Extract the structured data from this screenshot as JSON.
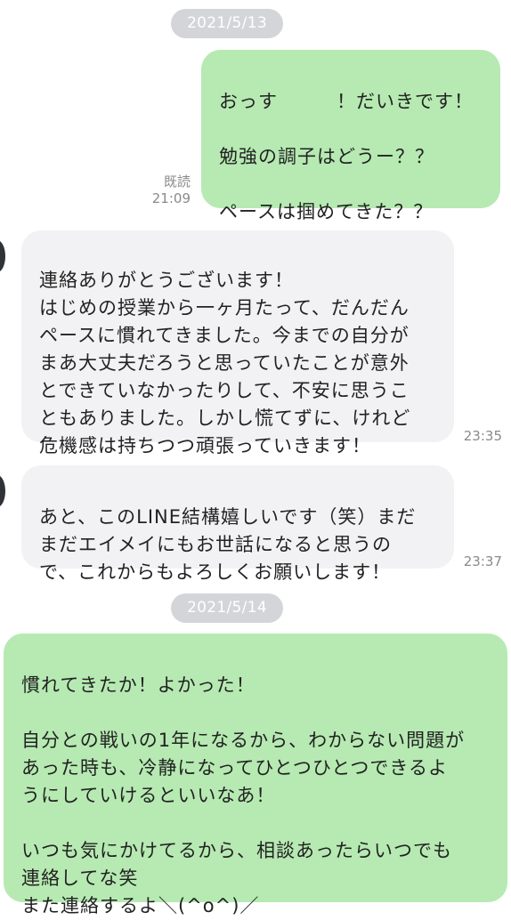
{
  "colors": {
    "outgoing_bubble": "#b6eab2",
    "incoming_bubble": "#f2f2f4",
    "date_pill": "#d4d5d9",
    "meta_text": "#8a8a8a"
  },
  "messages": {
    "date1": "2021/5/13",
    "out1": {
      "text": "おっす　　　！だいきです！\n\n勉強の調子はどうー？？\n\nペースは掴めてきた？？",
      "read": "既読",
      "time": "21:09"
    },
    "in1": {
      "text": "連絡ありがとうございます！\nはじめの授業から一ヶ月たって、だんだん\nペースに慣れてきました。今までの自分が\nまあ大丈夫だろうと思っていたことが意外\nとできていなかったりして、不安に思うこ\nともありました。しかし慌てずに、けれど\n危機感は持ちつつ頑張っていきます！",
      "time": "23:35"
    },
    "in2": {
      "text": "あと、このLINE結構嬉しいです（笑）まだ\nまだエイメイにもお世話になると思うの\nで、これからもよろしくお願いします！",
      "time": "23:37"
    },
    "date2": "2021/5/14",
    "out2": {
      "text": "慣れてきたか！よかった！\n\n自分との戦いの1年になるから、わからない問題が\nあった時も、冷静になってひとつひとつできるよ\nうにしていけるといいなあ！\n\nいつも気にかけてるから、相談あったらいつでも\n連絡してな笑\nまた連絡するよ＼(^o^)／"
    }
  }
}
